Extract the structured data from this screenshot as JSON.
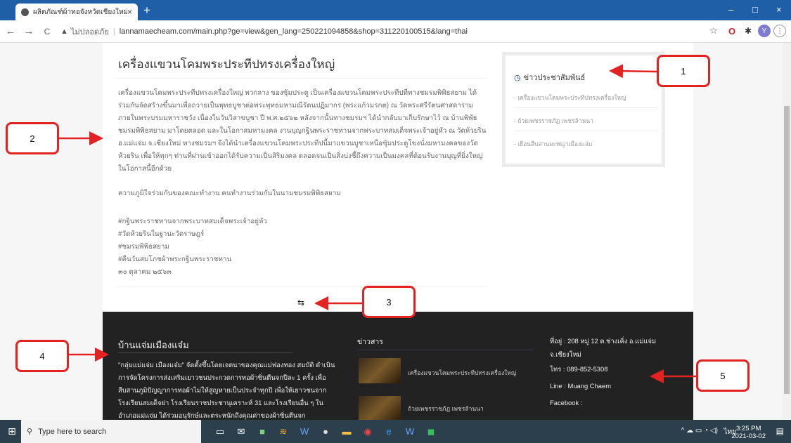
{
  "browser": {
    "tab_title": "ผลิตภัณฑ์ผ้าทอจังหวัดเชียงใหม่",
    "tab_close": "×",
    "new_tab": "+",
    "back": "←",
    "forward": "→",
    "reload": "C",
    "insecure_label": "ไม่ปลอดภัย",
    "url": "lannamaecheam.com/main.php?ge=view&gen_lang=250221094858&shop=311220100515&lang=thai",
    "window_min": "–",
    "window_max": "□",
    "window_close": "×",
    "ext_star": "☆",
    "ext_o": "O",
    "ext_puzzle": "✱",
    "ext_avatar": "Y",
    "ext_menu": "⋮"
  },
  "article": {
    "title": "เครื่องแขวนโคมพระประทีปทรงเครื่องใหญ่",
    "body": "เครื่องแขวนโคมพระประทีปทรงเครื่องใหญ่ พวกลาง ของซุ้มประตู เป็นเครื่องแขวนโคมพระประทีปที่ทางชมรมพิพิธสยาม ได้ร่วมกันจัดสร้างขึ้นมาเพื่อถวายเป็นพุทธบูชาต่อพระพุทธมหามณีรัตนปฏิมากร (พระแก้วมรกต) ณ วัดพระศรีรัตนศาสดาราม ภายในพระบรมมหาราชวัง เนื่องในวันวิสาขบูชา ปี พ.ศ.๒๕๖๒ หลังจากนั้นทางชมรมฯ ได้นำกลับมาเก็บรักษาไว้ ณ บ้านพิพัธ ชมรมพิพิธสยาม มาโดยตลอด และในโอกาสมหามงคล งานบุญกฐินพระราชทานจากพระบาทสมเด็จพระเจ้าอยู่หัว ณ วัดห้วยริน อ.แม่แจ่ม จ.เชียงใหม่ ทางชมรมฯ จึงได้นำเครื่องแขวนโคมพระประทีปนี้มาแขวนบูชาเหนือซุ้มประตูโขงนั่งมหามงคลของวัดห้วยริน เพื่อให้ทุกๆ ท่านที่ผ่านเข้าออกได้รับความเป็นสิริมงคล ตลอดจนเป็นสิ่งบ่งชี้ถึงความเป็นมงคลที่ต้อนรับงานบุญที่ยิ่งใหญ่ในโอกาสนี้อีกด้วย",
    "thanks": "ความภูมิใจร่วมกันของคณะทำงาน คนทำงานร่วมกันในนามชมรมพิพิธสยาม",
    "tags": [
      "#กฐินพระราชทานจากพระบาทสมเด็จพระเจ้าอยู่หัว",
      "#วัดห้วยรินในฐานะวัดราษฎร์",
      "#ชมรมพิพิธสยาม",
      "#คืนวันสมโภชผ้าพระกฐินพระราชทาน",
      "๓๐ ตุลาคม ๒๕๖๓"
    ],
    "share_icon": "⇆"
  },
  "sidebar": {
    "heading": "ข่าวประชาสัมพันธ์",
    "links": [
      "- เครื่องแขวนโคมพระประทีปทรงเครื่องใหญ่",
      "- ถ้วยเพชรราชภัฏ เพชรล้านนา",
      "- เยือนสืบสานผะหญาเมืองแจ่ม"
    ]
  },
  "footer": {
    "about_title": "บ้านแจ่มเมืองแจ๋ม",
    "about_body": "\"กลุ่มแม่แจ่ม เมืองแจ๋ม\" จัดตั้งขึ้นโดยเจตนาของคุณแม่ฟองทอง สมบัติ ดำเนินการจัดโครงการส่งเสริมเยาวชนประกวดการทอผ้าซิ่นตีนจกปีละ 1 ครั้ง เพื่อสืบสานภูมิปัญญาการทอผ้าไม่ให้สูญหายเป็นประจำทุกปี เพื่อให้เยาวชนจากโรงเรียนสมเด็จย่า โรงเรียนราชประชานุเคราะห์ 31 และโรงเรียนอื่น ๆ ในอำเภอแม่แจ่ม ได้ร่วมอนุรักษ์และตระหนักถึงคุณค่าของผ้าซิ่นตีนจก",
    "news_title": "ข่าวสาร",
    "news": [
      "เครื่องแขวนโคมพระประทีปทรงเครื่องใหญ่",
      "ถ้วยเพชรราชภัฏ เพชรล้านนา"
    ],
    "address": "ที่อยู่ : 208 หมู่ 12 ต.ช่างเคิ่ง อ.แม่แจ่ม",
    "address2": "จ.เชียงใหม่",
    "phone": "โทร : 089-852-5308",
    "line": "Line : Muang Chaem",
    "facebook": "Facebook :"
  },
  "callouts": [
    "1",
    "2",
    "3",
    "4",
    "5"
  ],
  "callout_color": "#e32222",
  "taskbar": {
    "start": "⊞",
    "search_placeholder": "Type here to search",
    "time": "3:25 PM",
    "date": "2021-03-02",
    "lang": "ไทย",
    "tray_icons": "^ ☁ ▭ ◔ ◁)",
    "notify": "▤"
  }
}
